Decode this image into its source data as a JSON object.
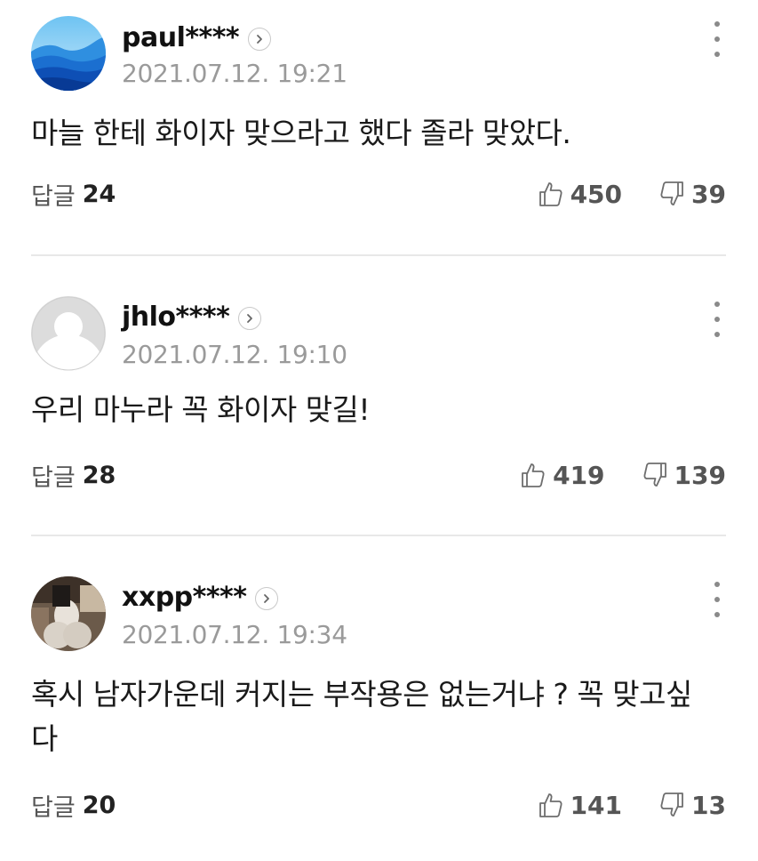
{
  "comments": [
    {
      "author": "paul****",
      "timestamp": "2021.07.12. 19:21",
      "text": "마늘 한테 화이자 맞으라고 했다 졸라 맞았다.",
      "reply_label": "답글",
      "reply_count": "24",
      "likes": "450",
      "dislikes": "39",
      "avatar": "mountain-landscape-avatar"
    },
    {
      "author": "jhlo****",
      "timestamp": "2021.07.12. 19:10",
      "text": "우리 마누라 꼭 화이자 맞길!",
      "reply_label": "답글",
      "reply_count": "28",
      "likes": "419",
      "dislikes": "139",
      "avatar": "default-user-avatar"
    },
    {
      "author": "xxpp****",
      "timestamp": "2021.07.12. 19:34",
      "text": "혹시 남자가운데 커지는 부작용은 없는거냐 ? 꼭 맞고싶다",
      "reply_label": "답글",
      "reply_count": "20",
      "likes": "141",
      "dislikes": "13",
      "avatar": "photo-avatar"
    }
  ],
  "colors": {
    "author": "#111111",
    "timestamp": "#9a9a9a",
    "divider": "#e8e8e8",
    "icon": "#6e6e6e"
  }
}
